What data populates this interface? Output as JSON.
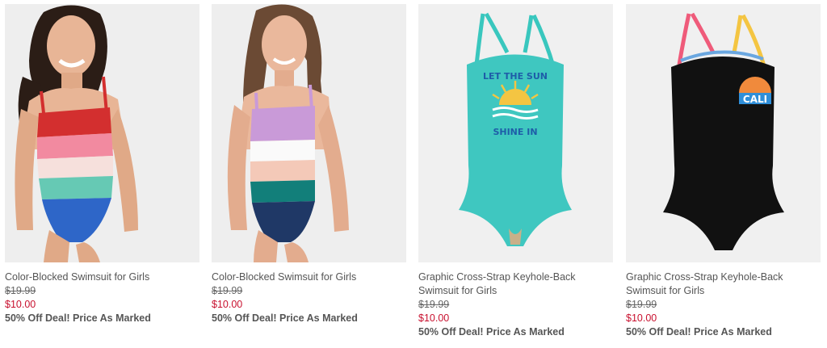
{
  "products": [
    {
      "title": "Color-Blocked Swimsuit for Girls",
      "original_price": "$19.99",
      "sale_price": "$10.00",
      "promo": "50% Off Deal! Price As Marked",
      "image": "girl-model-swimsuit-red-pink-white-teal-blue"
    },
    {
      "title": "Color-Blocked Swimsuit for Girls",
      "original_price": "$19.99",
      "sale_price": "$10.00",
      "promo": "50% Off Deal! Price As Marked",
      "image": "girl-model-swimsuit-lavender-white-peach-teal-navy"
    },
    {
      "title": "Graphic Cross-Strap Keyhole-Back Swimsuit for Girls",
      "original_price": "$19.99",
      "sale_price": "$10.00",
      "promo": "50% Off Deal! Price As Marked",
      "image": "turquoise-swimsuit-let-the-sun-shine-in",
      "graphic_text_top": "LET THE SUN",
      "graphic_text_bottom": "SHINE IN"
    },
    {
      "title": "Graphic Cross-Strap Keyhole-Back Swimsuit for Girls",
      "original_price": "$19.99",
      "sale_price": "$10.00",
      "promo": "50% Off Deal! Price As Marked",
      "image": "black-swimsuit-cali-graphic",
      "graphic_text": "CALI"
    }
  ],
  "colors": {
    "sale_red": "#c8102e",
    "text_gray": "#555555",
    "image_bg": "#efefef"
  }
}
